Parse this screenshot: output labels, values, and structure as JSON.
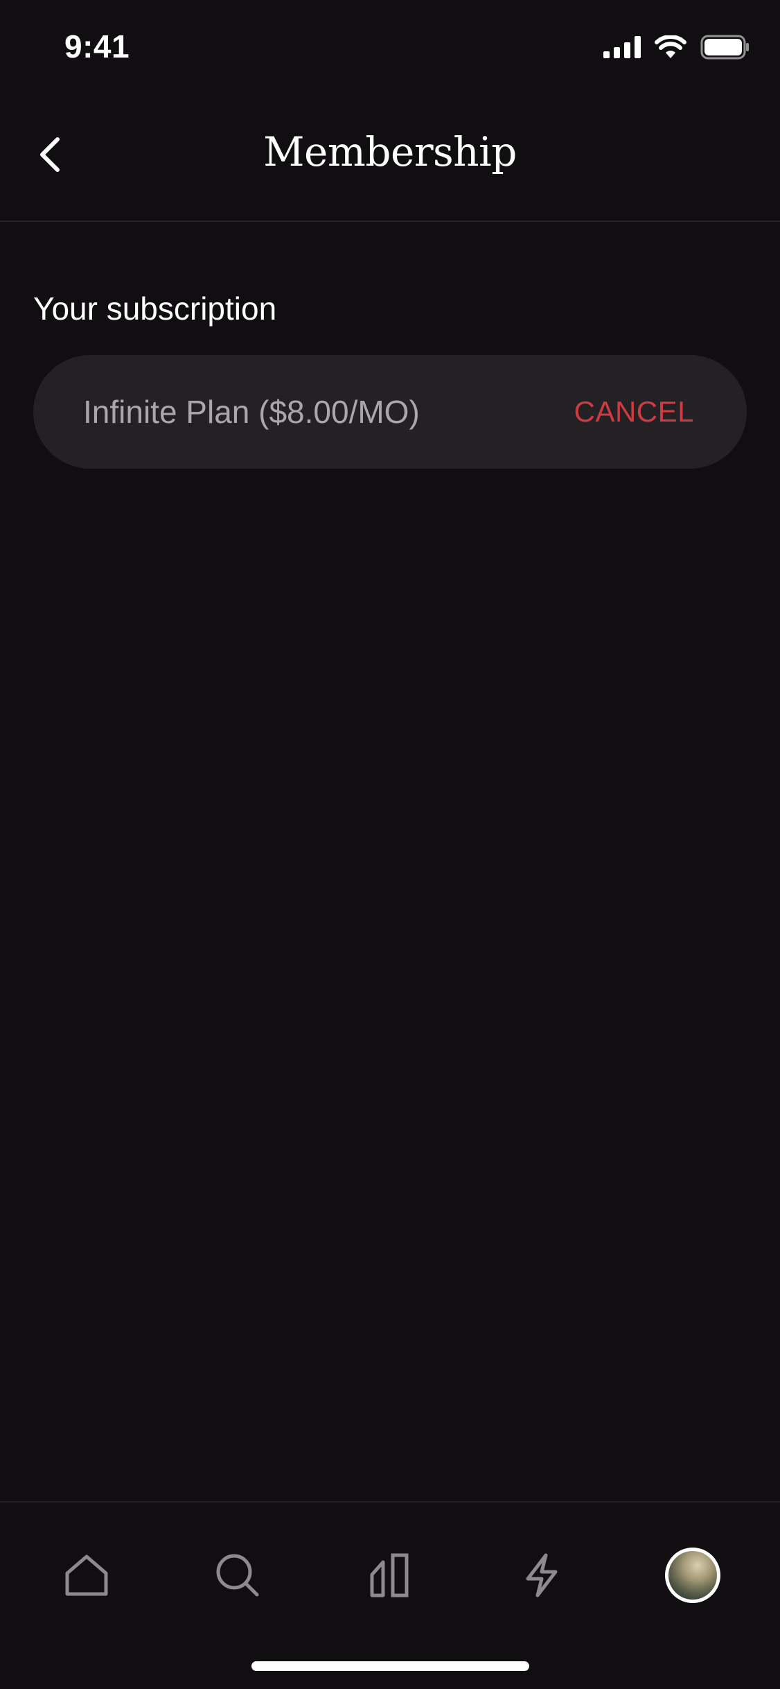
{
  "status_bar": {
    "time": "9:41"
  },
  "header": {
    "title": "Membership",
    "back_icon": "chevron-left-icon"
  },
  "subscription": {
    "section_label": "Your subscription",
    "plan_name": "Infinite Plan ($8.00/MO)",
    "cancel_label": "CANCEL"
  },
  "tab_bar": {
    "tabs": [
      {
        "id": "home",
        "icon": "home-icon"
      },
      {
        "id": "search",
        "icon": "search-icon"
      },
      {
        "id": "library",
        "icon": "library-icon"
      },
      {
        "id": "activity",
        "icon": "lightning-icon"
      },
      {
        "id": "profile",
        "icon": "avatar"
      }
    ]
  },
  "colors": {
    "background": "#110e11",
    "card": "#242124",
    "cancel": "#cd3b43",
    "muted_text": "#aaa6ab"
  }
}
